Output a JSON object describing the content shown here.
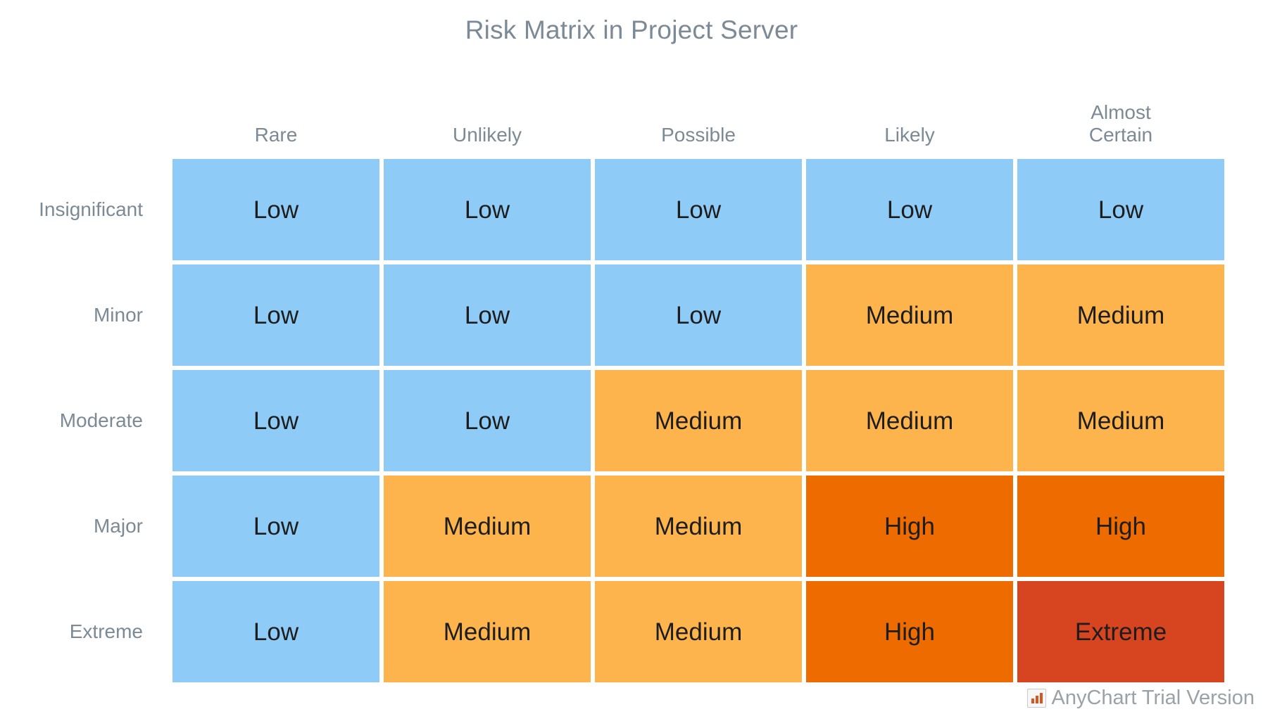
{
  "chart": {
    "title": "Risk Matrix in Project Server"
  },
  "watermark": {
    "text": "AnyChart Trial Version",
    "icon": "bar-chart-icon"
  },
  "chart_data": {
    "type": "heatmap",
    "title": "Risk Matrix in Project Server",
    "xlabel": "",
    "ylabel": "",
    "grid": false,
    "legend": "none",
    "x_categories": [
      "Rare",
      "Unlikely",
      "Possible",
      "Likely",
      "Almost Certain"
    ],
    "y_categories": [
      "Insignificant",
      "Minor",
      "Moderate",
      "Major",
      "Extreme"
    ],
    "value_labels": [
      "Low",
      "Medium",
      "High",
      "Extreme"
    ],
    "color_scale": {
      "Low": "#8ecbf7",
      "Medium": "#fdb44c",
      "High": "#ee6b00",
      "Extreme": "#d64420"
    },
    "rows": [
      {
        "label": "Insignificant",
        "cells": [
          {
            "x": "Rare",
            "value": "Low",
            "color": "#8ecbf7"
          },
          {
            "x": "Unlikely",
            "value": "Low",
            "color": "#8ecbf7"
          },
          {
            "x": "Possible",
            "value": "Low",
            "color": "#8ecbf7"
          },
          {
            "x": "Likely",
            "value": "Low",
            "color": "#8ecbf7"
          },
          {
            "x": "Almost Certain",
            "value": "Low",
            "color": "#8ecbf7"
          }
        ]
      },
      {
        "label": "Minor",
        "cells": [
          {
            "x": "Rare",
            "value": "Low",
            "color": "#8ecbf7"
          },
          {
            "x": "Unlikely",
            "value": "Low",
            "color": "#8ecbf7"
          },
          {
            "x": "Possible",
            "value": "Low",
            "color": "#8ecbf7"
          },
          {
            "x": "Likely",
            "value": "Medium",
            "color": "#fdb44c"
          },
          {
            "x": "Almost Certain",
            "value": "Medium",
            "color": "#fdb44c"
          }
        ]
      },
      {
        "label": "Moderate",
        "cells": [
          {
            "x": "Rare",
            "value": "Low",
            "color": "#8ecbf7"
          },
          {
            "x": "Unlikely",
            "value": "Low",
            "color": "#8ecbf7"
          },
          {
            "x": "Possible",
            "value": "Medium",
            "color": "#fdb44c"
          },
          {
            "x": "Likely",
            "value": "Medium",
            "color": "#fdb44c"
          },
          {
            "x": "Almost Certain",
            "value": "Medium",
            "color": "#fdb44c"
          }
        ]
      },
      {
        "label": "Major",
        "cells": [
          {
            "x": "Rare",
            "value": "Low",
            "color": "#8ecbf7"
          },
          {
            "x": "Unlikely",
            "value": "Medium",
            "color": "#fdb44c"
          },
          {
            "x": "Possible",
            "value": "Medium",
            "color": "#fdb44c"
          },
          {
            "x": "Likely",
            "value": "High",
            "color": "#ee6b00"
          },
          {
            "x": "Almost Certain",
            "value": "High",
            "color": "#ee6b00"
          }
        ]
      },
      {
        "label": "Extreme",
        "cells": [
          {
            "x": "Rare",
            "value": "Low",
            "color": "#8ecbf7"
          },
          {
            "x": "Unlikely",
            "value": "Medium",
            "color": "#fdb44c"
          },
          {
            "x": "Possible",
            "value": "Medium",
            "color": "#fdb44c"
          },
          {
            "x": "Likely",
            "value": "High",
            "color": "#ee6b00"
          },
          {
            "x": "Almost Certain",
            "value": "Extreme",
            "color": "#d64420"
          }
        ]
      }
    ]
  }
}
